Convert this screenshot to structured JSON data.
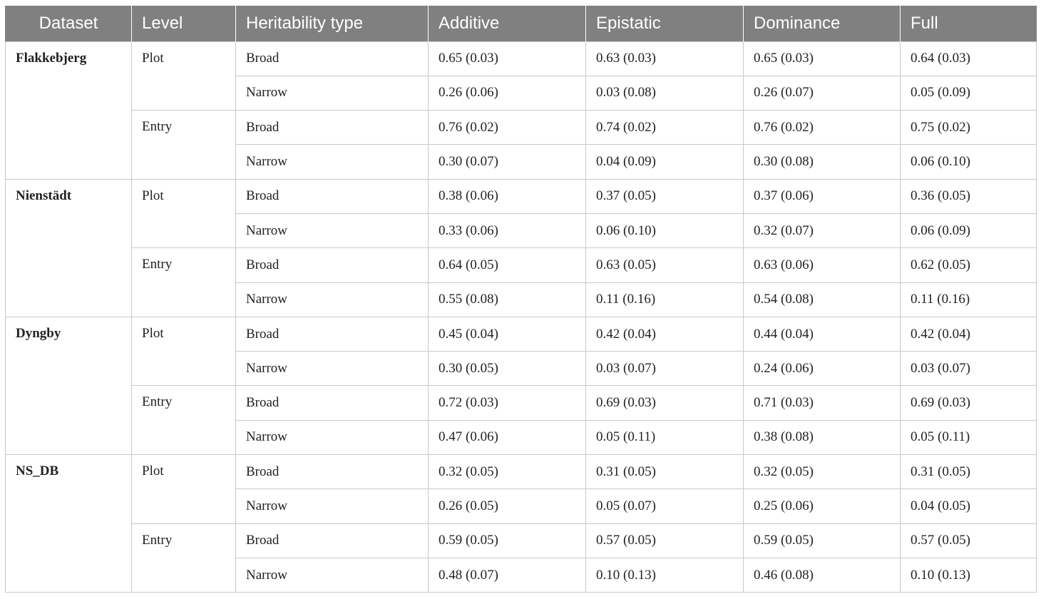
{
  "table": {
    "headers": [
      "Dataset",
      "Level",
      "Heritability type",
      "Additive",
      "Epistatic",
      "Dominance",
      "Full"
    ],
    "datasets": [
      {
        "name": "Flakkebjerg",
        "levels": [
          {
            "name": "Plot",
            "rows": [
              {
                "type": "Broad",
                "values": [
                  "0.65 (0.03)",
                  "0.63 (0.03)",
                  "0.65 (0.03)",
                  "0.64 (0.03)"
                ]
              },
              {
                "type": "Narrow",
                "values": [
                  "0.26 (0.06)",
                  "0.03 (0.08)",
                  "0.26 (0.07)",
                  "0.05 (0.09)"
                ]
              }
            ]
          },
          {
            "name": "Entry",
            "rows": [
              {
                "type": "Broad",
                "values": [
                  "0.76 (0.02)",
                  "0.74 (0.02)",
                  "0.76 (0.02)",
                  "0.75 (0.02)"
                ]
              },
              {
                "type": "Narrow",
                "values": [
                  "0.30 (0.07)",
                  "0.04 (0.09)",
                  "0.30 (0.08)",
                  "0.06 (0.10)"
                ]
              }
            ]
          }
        ]
      },
      {
        "name": "Nienstädt",
        "levels": [
          {
            "name": "Plot",
            "rows": [
              {
                "type": "Broad",
                "values": [
                  "0.38 (0.06)",
                  "0.37 (0.05)",
                  "0.37 (0.06)",
                  "0.36 (0.05)"
                ]
              },
              {
                "type": "Narrow",
                "values": [
                  "0.33 (0.06)",
                  "0.06 (0.10)",
                  "0.32 (0.07)",
                  "0.06 (0.09)"
                ]
              }
            ]
          },
          {
            "name": "Entry",
            "rows": [
              {
                "type": "Broad",
                "values": [
                  "0.64 (0.05)",
                  "0.63 (0.05)",
                  "0.63 (0.06)",
                  "0.62 (0.05)"
                ]
              },
              {
                "type": "Narrow",
                "values": [
                  "0.55 (0.08)",
                  "0.11 (0.16)",
                  "0.54 (0.08)",
                  "0.11 (0.16)"
                ]
              }
            ]
          }
        ]
      },
      {
        "name": "Dyngby",
        "levels": [
          {
            "name": "Plot",
            "rows": [
              {
                "type": "Broad",
                "values": [
                  "0.45 (0.04)",
                  "0.42 (0.04)",
                  "0.44 (0.04)",
                  "0.42 (0.04)"
                ]
              },
              {
                "type": "Narrow",
                "values": [
                  "0.30 (0.05)",
                  "0.03 (0.07)",
                  "0.24 (0.06)",
                  "0.03 (0.07)"
                ]
              }
            ]
          },
          {
            "name": "Entry",
            "rows": [
              {
                "type": "Broad",
                "values": [
                  "0.72 (0.03)",
                  "0.69 (0.03)",
                  "0.71 (0.03)",
                  "0.69 (0.03)"
                ]
              },
              {
                "type": "Narrow",
                "values": [
                  "0.47 (0.06)",
                  "0.05 (0.11)",
                  "0.38 (0.08)",
                  "0.05 (0.11)"
                ]
              }
            ]
          }
        ]
      },
      {
        "name": "NS_DB",
        "levels": [
          {
            "name": "Plot",
            "rows": [
              {
                "type": "Broad",
                "values": [
                  "0.32 (0.05)",
                  "0.31 (0.05)",
                  "0.32 (0.05)",
                  "0.31 (0.05)"
                ]
              },
              {
                "type": "Narrow",
                "values": [
                  "0.26 (0.05)",
                  "0.05 (0.07)",
                  "0.25 (0.06)",
                  "0.04 (0.05)"
                ]
              }
            ]
          },
          {
            "name": "Entry",
            "rows": [
              {
                "type": "Broad",
                "values": [
                  "0.59 (0.05)",
                  "0.57 (0.05)",
                  "0.59 (0.05)",
                  "0.57 (0.05)"
                ]
              },
              {
                "type": "Narrow",
                "values": [
                  "0.48 (0.07)",
                  "0.10 (0.13)",
                  "0.46 (0.08)",
                  "0.10 (0.13)"
                ]
              }
            ]
          }
        ]
      }
    ]
  }
}
